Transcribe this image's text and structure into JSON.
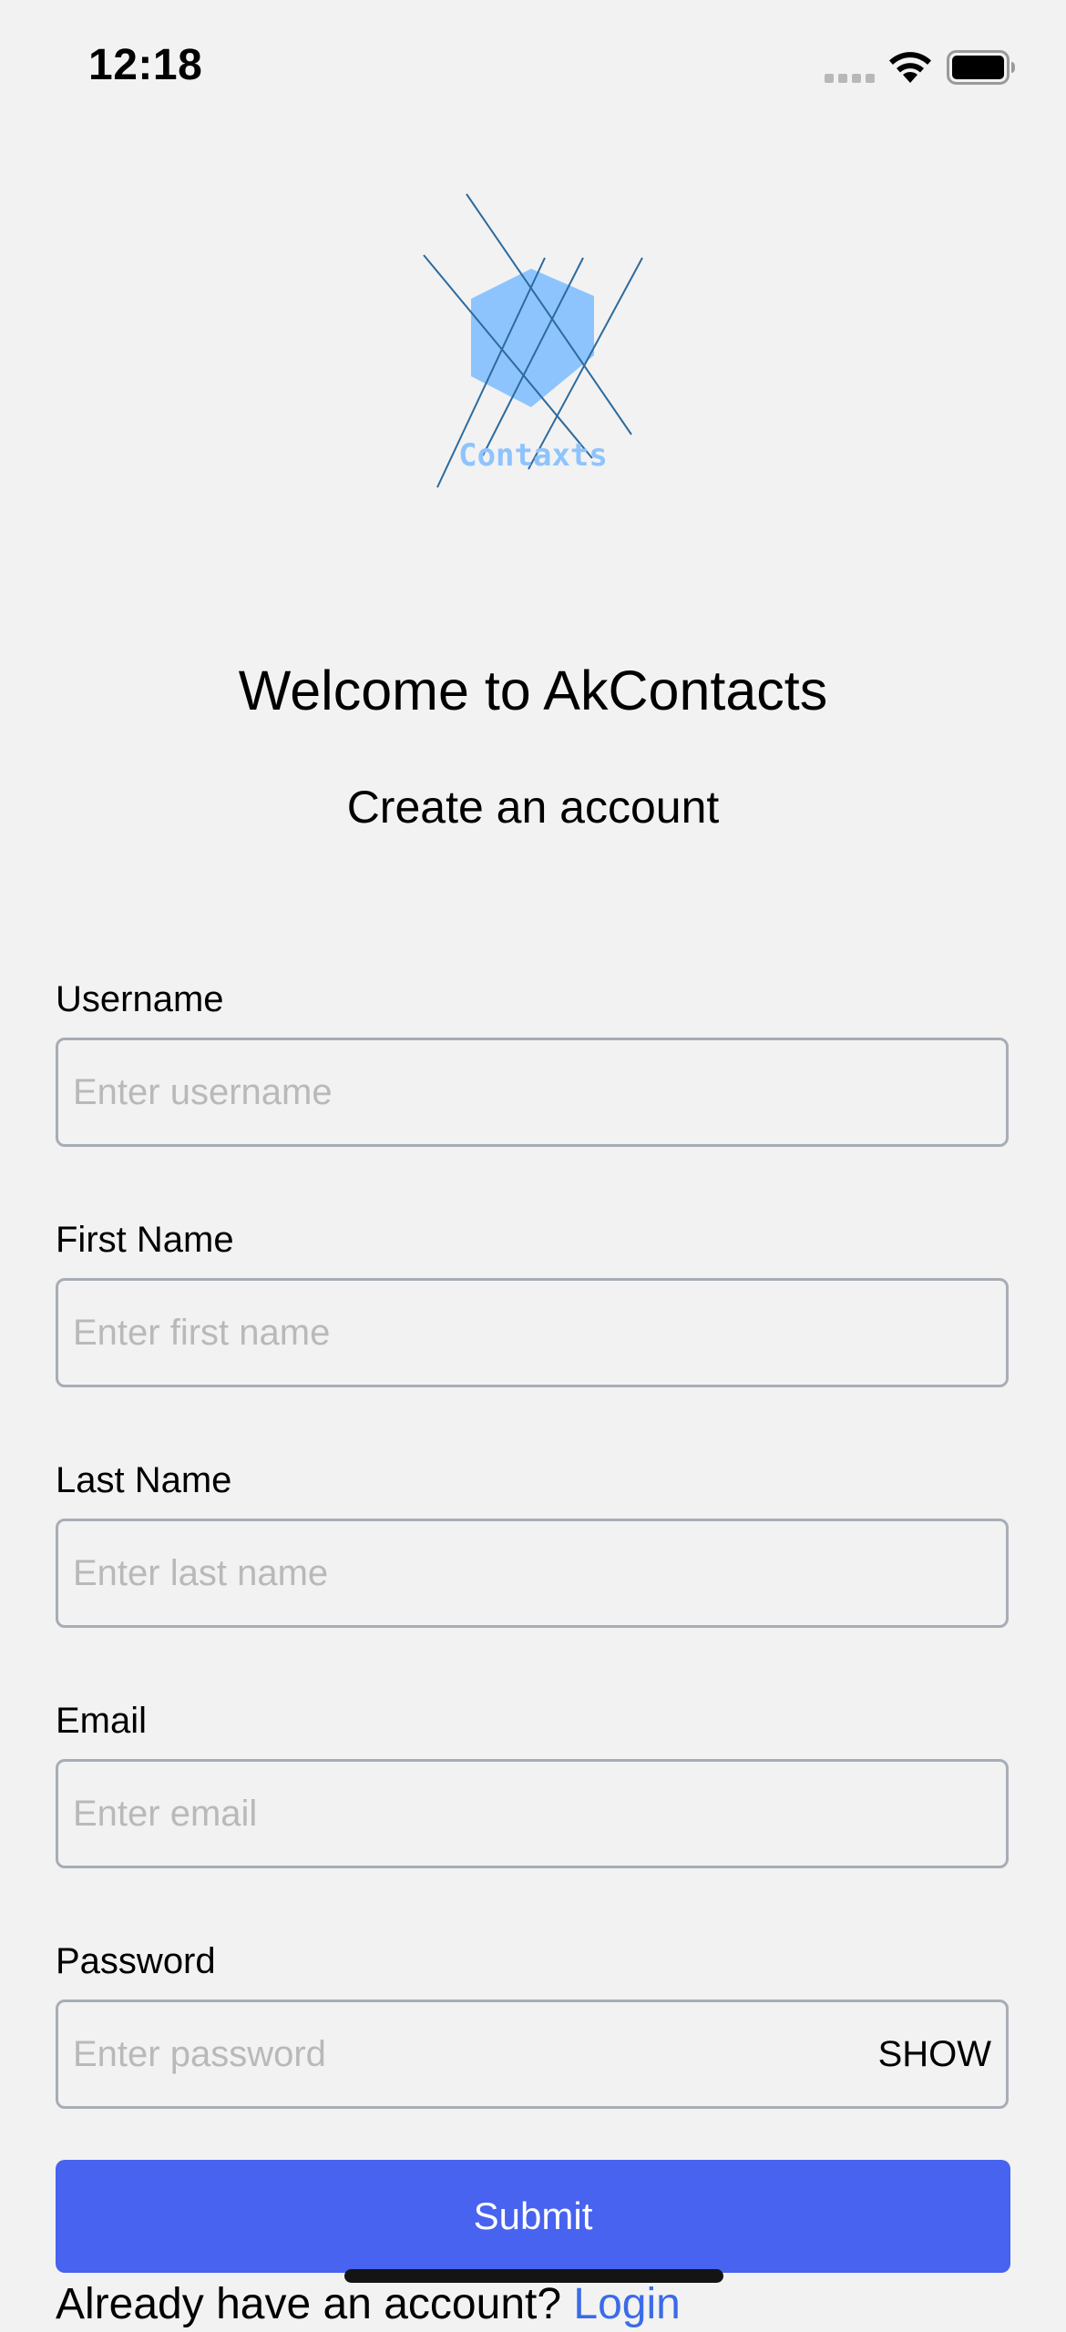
{
  "status_bar": {
    "time": "12:18"
  },
  "logo": {
    "text": "Contaxts",
    "hex_color": "#8ec4fd",
    "line_color": "#2d6a9d"
  },
  "header": {
    "title": "Welcome to AkContacts",
    "subtitle": "Create an account"
  },
  "form": {
    "username": {
      "label": "Username",
      "placeholder": "Enter username",
      "value": ""
    },
    "first_name": {
      "label": "First Name",
      "placeholder": "Enter first name",
      "value": ""
    },
    "last_name": {
      "label": "Last Name",
      "placeholder": "Enter last name",
      "value": ""
    },
    "email": {
      "label": "Email",
      "placeholder": "Enter email",
      "value": ""
    },
    "password": {
      "label": "Password",
      "placeholder": "Enter password",
      "value": "",
      "toggle_label": "SHOW"
    },
    "submit_label": "Submit"
  },
  "footer": {
    "prompt": "Already have an account? ",
    "login_link": "Login"
  },
  "colors": {
    "background": "#f2f2f2",
    "accent": "#4763ef",
    "field_border": "#a7adb6",
    "placeholder": "#b9b9b9",
    "link": "#3b6be8"
  }
}
